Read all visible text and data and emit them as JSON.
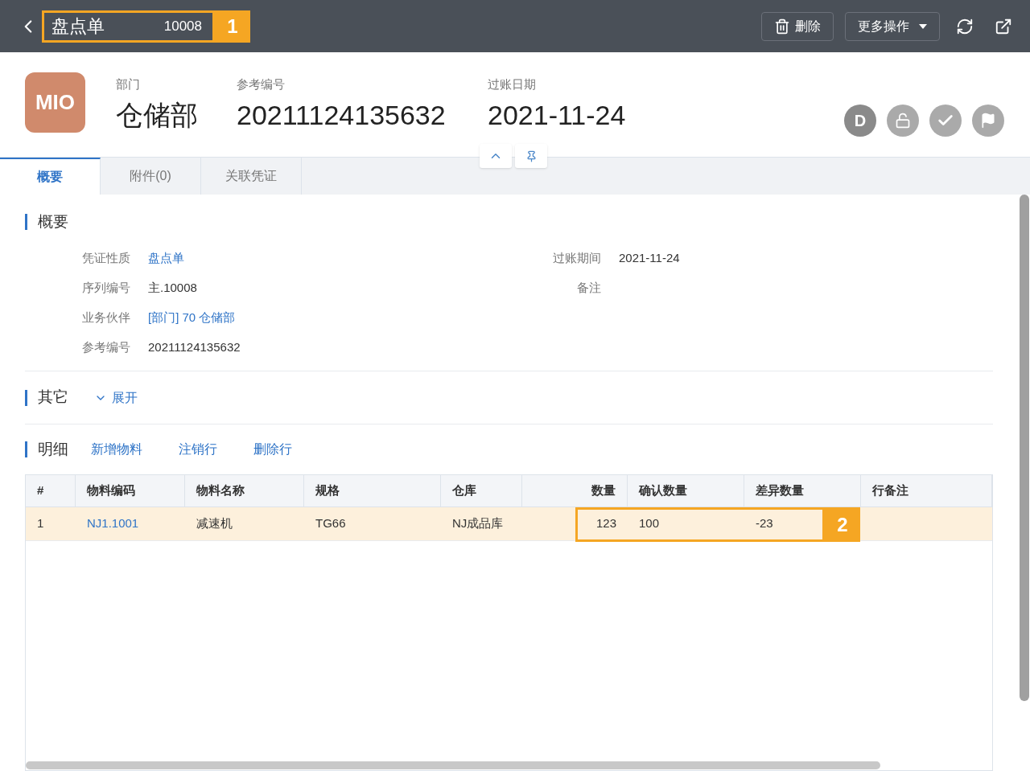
{
  "top_bar": {
    "title": "盘点单",
    "number": "10008",
    "callout": "1",
    "actions": [
      {
        "kind": "delete",
        "label": "删除"
      },
      {
        "kind": "dropdown",
        "label": "更多操作"
      }
    ]
  },
  "header": {
    "logo": "MIO",
    "fields": [
      {
        "label": "部门",
        "value": "仓储部"
      },
      {
        "label": "参考编号",
        "value": "20211124135632"
      },
      {
        "label": "过账日期",
        "value": "2021-11-24"
      }
    ],
    "status_badges": [
      {
        "kind": "letter",
        "text": "D"
      },
      {
        "kind": "lock"
      },
      {
        "kind": "check"
      },
      {
        "kind": "flag"
      }
    ]
  },
  "tabs": [
    {
      "label": "概要",
      "selected": true
    },
    {
      "label": "附件(0)",
      "selected": false
    },
    {
      "label": "关联凭证",
      "selected": false
    }
  ],
  "summary": {
    "title": "概要",
    "left": [
      {
        "label": "凭证性质",
        "value": "盘点单",
        "kind": "link"
      },
      {
        "label": "序列编号",
        "value": "主.10008",
        "kind": "text"
      },
      {
        "label": "业务伙伴",
        "value": "[部门] 70 仓储部",
        "kind": "link"
      },
      {
        "label": "参考编号",
        "value": "20211124135632",
        "kind": "text"
      }
    ],
    "right": [
      {
        "label": "过账期间",
        "value": "2021-11-24"
      },
      {
        "label": "备注"
      }
    ]
  },
  "other": {
    "title": "其它",
    "toggle": "展开",
    "expanded": false
  },
  "details": {
    "title": "明细",
    "actions": [
      "新增物料",
      "注销行",
      "删除行"
    ],
    "columns": [
      "#",
      "物料编码",
      "物料名称",
      "规格",
      "仓库",
      "数量",
      "确认数量",
      "差异数量",
      "行备注"
    ],
    "rows": [
      {
        "selected": true,
        "cells": [
          "1",
          "NJ1.1001",
          "减速机",
          "TG66",
          "NJ成品库",
          "123",
          "100",
          "-23",
          ""
        ]
      }
    ],
    "callout": "2"
  }
}
